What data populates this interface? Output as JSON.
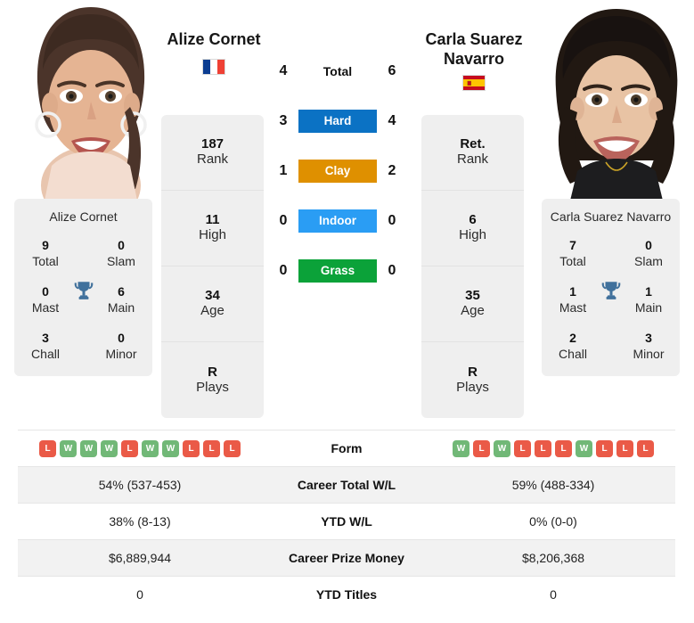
{
  "players": {
    "left": {
      "name": "Alize Cornet",
      "flag": "flag-france",
      "rank": "187",
      "rank_label": "Rank",
      "high": "11",
      "high_label": "High",
      "age": "34",
      "age_label": "Age",
      "plays": "R",
      "plays_label": "Plays",
      "titles": {
        "total": "9",
        "total_label": "Total",
        "slam": "0",
        "slam_label": "Slam",
        "mast": "0",
        "mast_label": "Mast",
        "main": "6",
        "main_label": "Main",
        "chall": "3",
        "chall_label": "Chall",
        "minor": "0",
        "minor_label": "Minor"
      },
      "form": [
        "L",
        "W",
        "W",
        "W",
        "L",
        "W",
        "W",
        "L",
        "L",
        "L"
      ],
      "career_wl": "54% (537-453)",
      "ytd_wl": "38% (8-13)",
      "career_prize": "$6,889,944",
      "ytd_titles": "0"
    },
    "right": {
      "name": "Carla Suarez Navarro",
      "flag": "flag-spain",
      "rank": "Ret.",
      "rank_label": "Rank",
      "high": "6",
      "high_label": "High",
      "age": "35",
      "age_label": "Age",
      "plays": "R",
      "plays_label": "Plays",
      "titles": {
        "total": "7",
        "total_label": "Total",
        "slam": "0",
        "slam_label": "Slam",
        "mast": "1",
        "mast_label": "Mast",
        "main": "1",
        "main_label": "Main",
        "chall": "2",
        "chall_label": "Chall",
        "minor": "3",
        "minor_label": "Minor"
      },
      "form": [
        "W",
        "L",
        "W",
        "L",
        "L",
        "L",
        "W",
        "L",
        "L",
        "L"
      ],
      "career_wl": "59% (488-334)",
      "ytd_wl": "0% (0-0)",
      "career_prize": "$8,206,368",
      "ytd_titles": "0"
    }
  },
  "head_to_head": [
    {
      "label": "Total",
      "left": "4",
      "right": "6",
      "color": ""
    },
    {
      "label": "Hard",
      "left": "3",
      "right": "4",
      "color": "#0b72c4"
    },
    {
      "label": "Clay",
      "left": "1",
      "right": "2",
      "color": "#df9000"
    },
    {
      "label": "Indoor",
      "left": "0",
      "right": "0",
      "color": "#2a9df4"
    },
    {
      "label": "Grass",
      "left": "0",
      "right": "0",
      "color": "#0ba239"
    }
  ],
  "stats_rows": [
    {
      "label": "Form",
      "left": "",
      "right": ""
    },
    {
      "label": "Career Total W/L",
      "left": "54% (537-453)",
      "right": "59% (488-334)"
    },
    {
      "label": "YTD W/L",
      "left": "38% (8-13)",
      "right": "0% (0-0)"
    },
    {
      "label": "Career Prize Money",
      "left": "$6,889,944",
      "right": "$8,206,368"
    },
    {
      "label": "YTD Titles",
      "left": "0",
      "right": "0"
    }
  ],
  "colors": {
    "win": "#71b877",
    "loss": "#ea5a47",
    "card_bg": "#efefef",
    "stripe": "#f2f2f2"
  }
}
